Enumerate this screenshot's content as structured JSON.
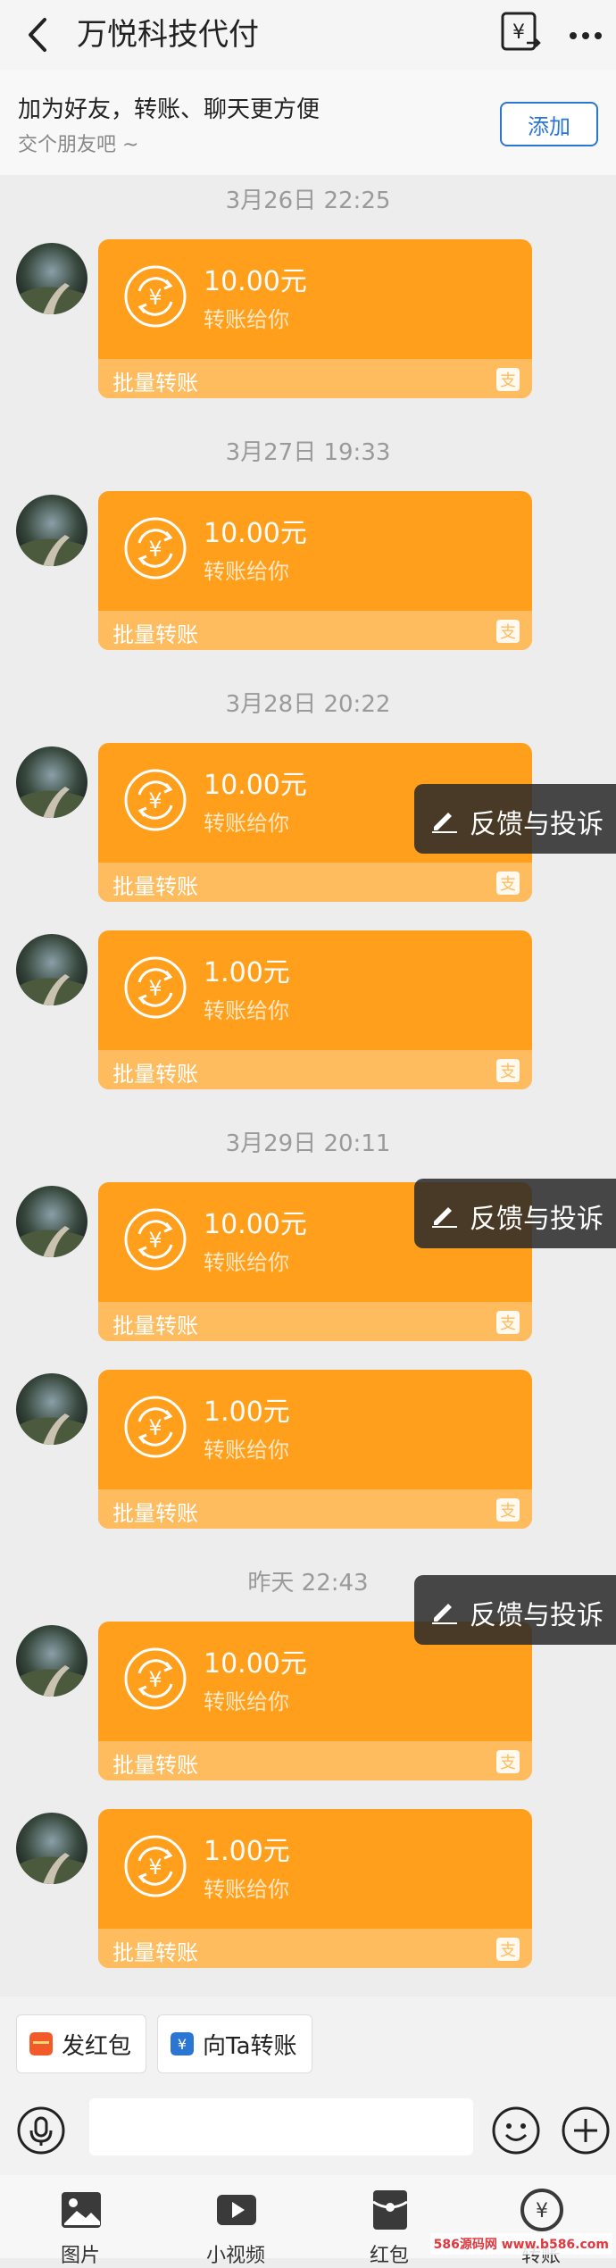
{
  "header": {
    "title": "万悦科技代付"
  },
  "friend_bar": {
    "title": "加为好友，转账、聊天更方便",
    "subtitle": "交个朋友吧 ~",
    "add_label": "添加"
  },
  "timestamps": [
    "3月26日 22:25",
    "3月27日 19:33",
    "3月28日 20:22",
    "3月29日 20:11",
    "昨天 22:43"
  ],
  "messages": [
    {
      "amount": "10.00元",
      "note": "转账给你",
      "footer": "批量转账"
    },
    {
      "amount": "10.00元",
      "note": "转账给你",
      "footer": "批量转账"
    },
    {
      "amount": "10.00元",
      "note": "转账给你",
      "footer": "批量转账"
    },
    {
      "amount": "1.00元",
      "note": "转账给你",
      "footer": "批量转账"
    },
    {
      "amount": "10.00元",
      "note": "转账给你",
      "footer": "批量转账"
    },
    {
      "amount": "1.00元",
      "note": "转账给你",
      "footer": "批量转账"
    },
    {
      "amount": "10.00元",
      "note": "转账给你",
      "footer": "批量转账"
    },
    {
      "amount": "1.00元",
      "note": "转账给你",
      "footer": "批量转账"
    }
  ],
  "complaint_label": "反馈与投诉",
  "quick_actions": {
    "red_packet": "发红包",
    "transfer": "向Ta转账"
  },
  "input": {
    "placeholder": ""
  },
  "toolbar": {
    "image": "图片",
    "video": "小视频",
    "red_packet": "红包",
    "transfer": "转账"
  },
  "watermark": "586源码网 www.b586.com",
  "colors": {
    "bubble": "#ff9f1c",
    "bubble_footer": "#ffbc5e",
    "accent_blue": "#2a76d2",
    "red_packet": "#f25a29"
  }
}
